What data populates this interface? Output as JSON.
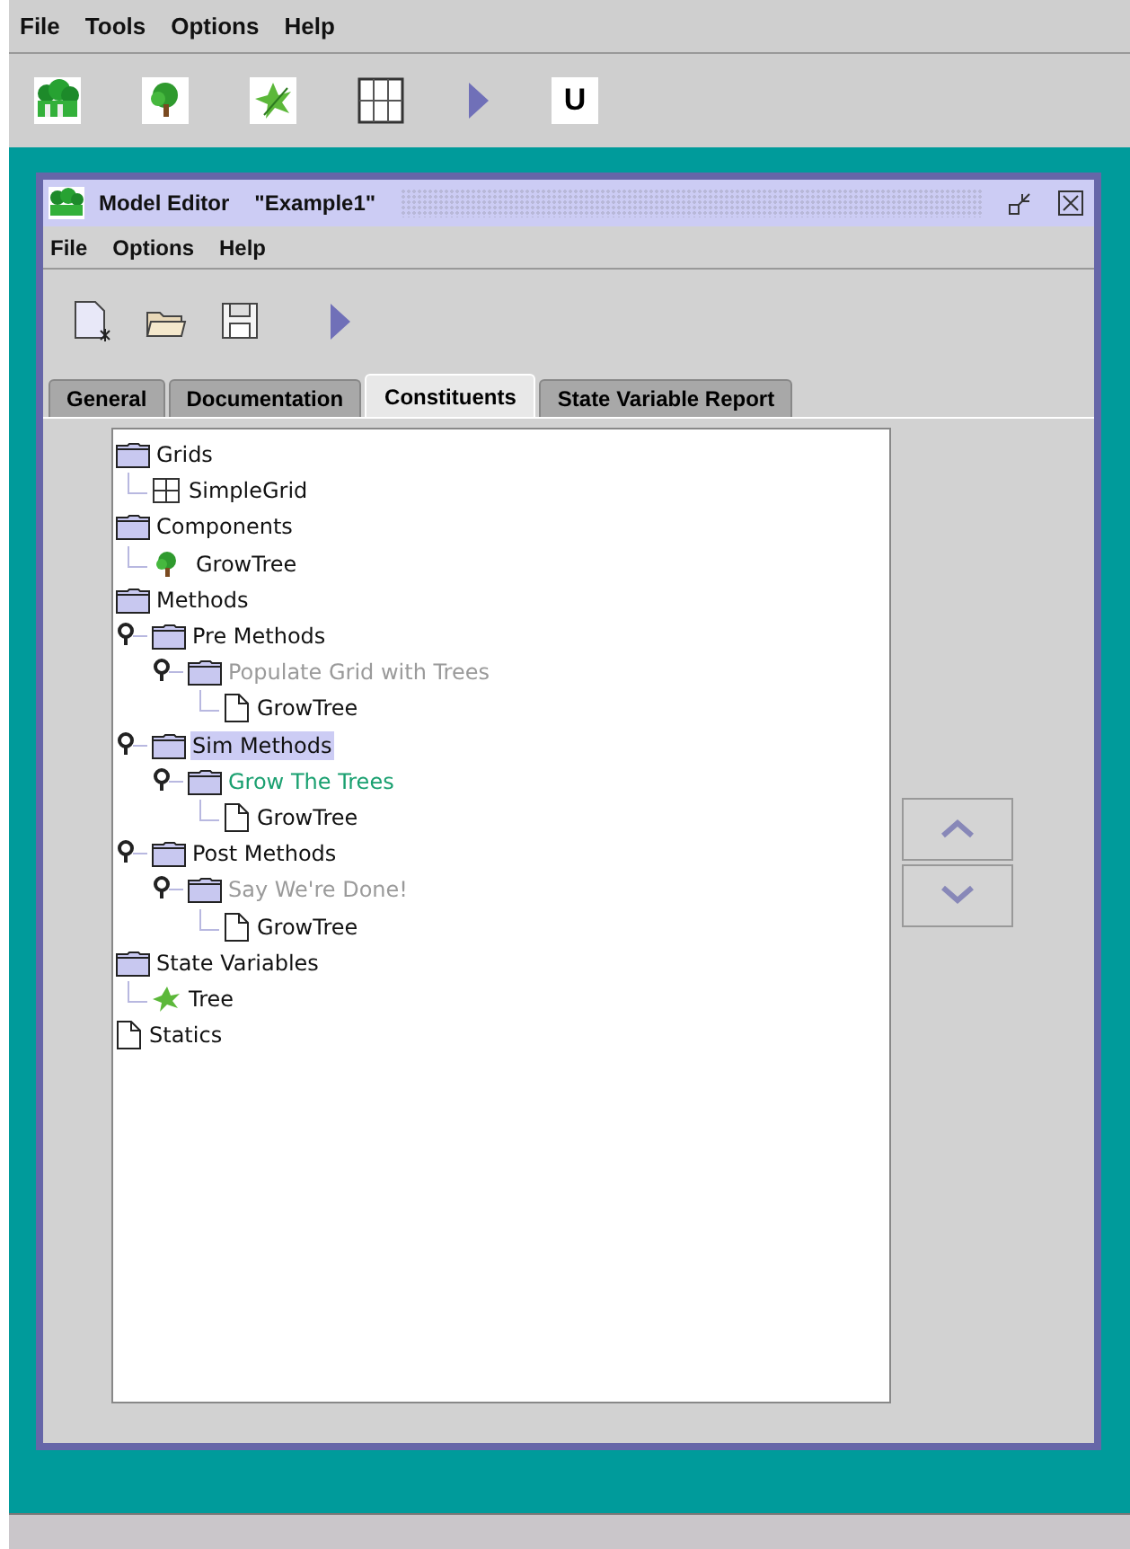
{
  "menu_bar": [
    "File",
    "Tools",
    "Options",
    "Help"
  ],
  "toolbar": [
    {
      "kind": "forest"
    },
    {
      "kind": "tree"
    },
    {
      "kind": "leaf"
    },
    {
      "kind": "grid"
    },
    {
      "kind": "run"
    },
    {
      "kind": "letter",
      "label": "U"
    }
  ],
  "window": {
    "title": "Model Editor",
    "subtitle": "\"Example1\"",
    "menu_bar": [
      "File",
      "Options",
      "Help"
    ],
    "toolbar": [
      {
        "kind": "new"
      },
      {
        "kind": "open"
      },
      {
        "kind": "save"
      },
      {
        "kind": "run"
      }
    ],
    "tabs": [
      {
        "label": "General",
        "selected": false
      },
      {
        "label": "Documentation",
        "selected": false
      },
      {
        "label": "Constituents",
        "selected": true
      },
      {
        "label": "State Variable Report",
        "selected": false
      }
    ],
    "tree": [
      {
        "label": "Grids",
        "kind": "folder",
        "selected": false,
        "children": [
          {
            "label": "SimpleGrid",
            "kind": "grid",
            "selected": false
          }
        ]
      },
      {
        "label": "Components",
        "kind": "folder",
        "selected": false,
        "children": [
          {
            "label": "GrowTree",
            "kind": "tree",
            "selected": false
          }
        ]
      },
      {
        "label": "Methods",
        "kind": "folder",
        "selected": false,
        "children": [
          {
            "label": "Pre Methods",
            "kind": "folder",
            "selected": false,
            "children": [
              {
                "label": "Populate Grid with Trees",
                "kind": "folder",
                "selected": false,
                "disabled": true,
                "active": false,
                "children": [
                  {
                    "label": "GrowTree",
                    "kind": "doc",
                    "selected": false
                  }
                ]
              }
            ]
          },
          {
            "label": "Sim Methods",
            "kind": "folder",
            "selected": true,
            "children": [
              {
                "label": "Grow The Trees",
                "kind": "folder",
                "selected": false,
                "disabled": false,
                "active": true,
                "children": [
                  {
                    "label": "GrowTree",
                    "kind": "doc",
                    "selected": false
                  }
                ]
              }
            ]
          },
          {
            "label": "Post Methods",
            "kind": "folder",
            "selected": false,
            "children": [
              {
                "label": "Say We're Done!",
                "kind": "folder",
                "selected": false,
                "disabled": true,
                "active": false,
                "children": [
                  {
                    "label": "GrowTree",
                    "kind": "doc",
                    "selected": false
                  }
                ]
              }
            ]
          }
        ]
      },
      {
        "label": "State Variables",
        "kind": "folder",
        "selected": false,
        "children": [
          {
            "label": "Tree",
            "kind": "leaf",
            "selected": false
          }
        ]
      },
      {
        "label": "Statics",
        "kind": "doc",
        "selected": false
      }
    ],
    "side_buttons": [
      {
        "kind": "up"
      },
      {
        "kind": "down"
      }
    ]
  }
}
